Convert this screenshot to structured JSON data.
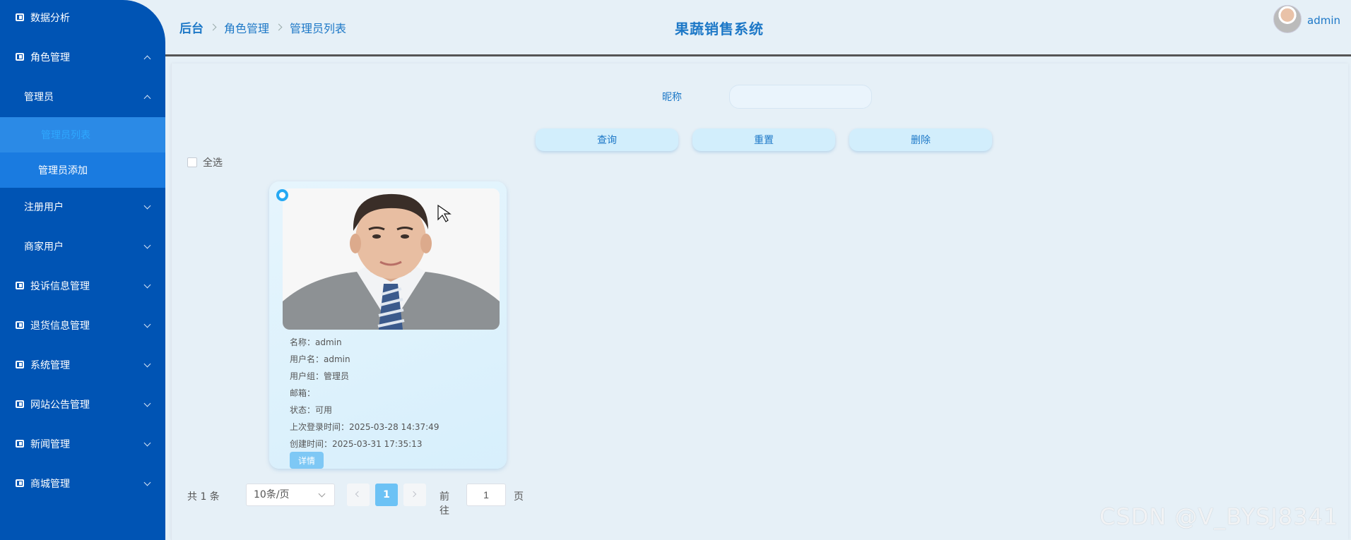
{
  "header": {
    "breadcrumb": [
      "后台",
      "角色管理",
      "管理员列表"
    ],
    "title": "果蔬销售系统",
    "user": "admin"
  },
  "sidebar": {
    "items": [
      {
        "label": "数据分析"
      },
      {
        "label": "角色管理"
      },
      {
        "label": "管理员"
      },
      {
        "label": "管理员列表"
      },
      {
        "label": "管理员添加"
      },
      {
        "label": "注册用户"
      },
      {
        "label": "商家用户"
      },
      {
        "label": "投诉信息管理"
      },
      {
        "label": "退货信息管理"
      },
      {
        "label": "系统管理"
      },
      {
        "label": "网站公告管理"
      },
      {
        "label": "新闻管理"
      },
      {
        "label": "商城管理"
      }
    ]
  },
  "search": {
    "label": "昵称",
    "value": "",
    "query_btn": "查询",
    "reset_btn": "重置",
    "delete_btn": "删除",
    "select_all": "全选"
  },
  "card": {
    "name": "名称：admin",
    "username": "用户名：admin",
    "group": "用户组：管理员",
    "email": "邮箱：",
    "status": "状态：可用",
    "last_login": "上次登录时间：2025-03-28 14:37:49",
    "created": "创建时间：2025-03-31 17:35:13",
    "detail_btn": "详情"
  },
  "pagination": {
    "total": "共 1 条",
    "page_size": "10条/页",
    "current": "1",
    "goto_label": "前往",
    "goto_value": "1",
    "page_suffix": "页"
  },
  "watermark": "CSDN @V_BYSJ8341",
  "colors": {
    "sidebar": "#0054b4",
    "accent": "#1d78c7",
    "active_page": "#6cc2f5"
  }
}
